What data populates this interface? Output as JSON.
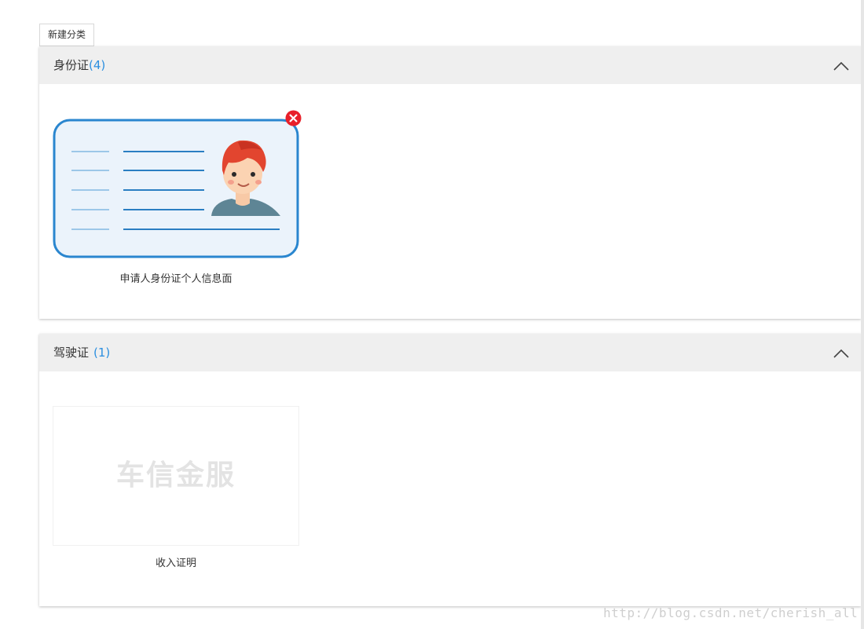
{
  "toolbar": {
    "new_category_label": "新建分类"
  },
  "categories": [
    {
      "title": "身份证",
      "count": "(4)",
      "collapse_icon": "chevron-up-icon",
      "items": [
        {
          "label": "申请人身份证个人信息面",
          "image": "id-card-illustration",
          "delete_icon": "close-circle-icon"
        }
      ]
    },
    {
      "title": "驾驶证",
      "count": "(1)",
      "collapse_icon": "chevron-up-icon",
      "items": [
        {
          "label": "收入证明",
          "placeholder": "车信金服"
        }
      ]
    }
  ],
  "watermark": "http://blog.csdn.net/cherish_all",
  "colors": {
    "accent": "#2b8fe0",
    "header_bg": "#efefef",
    "delete_red": "#e8202a",
    "card_border": "#2a86cf",
    "card_fill": "#ebf3fb"
  }
}
